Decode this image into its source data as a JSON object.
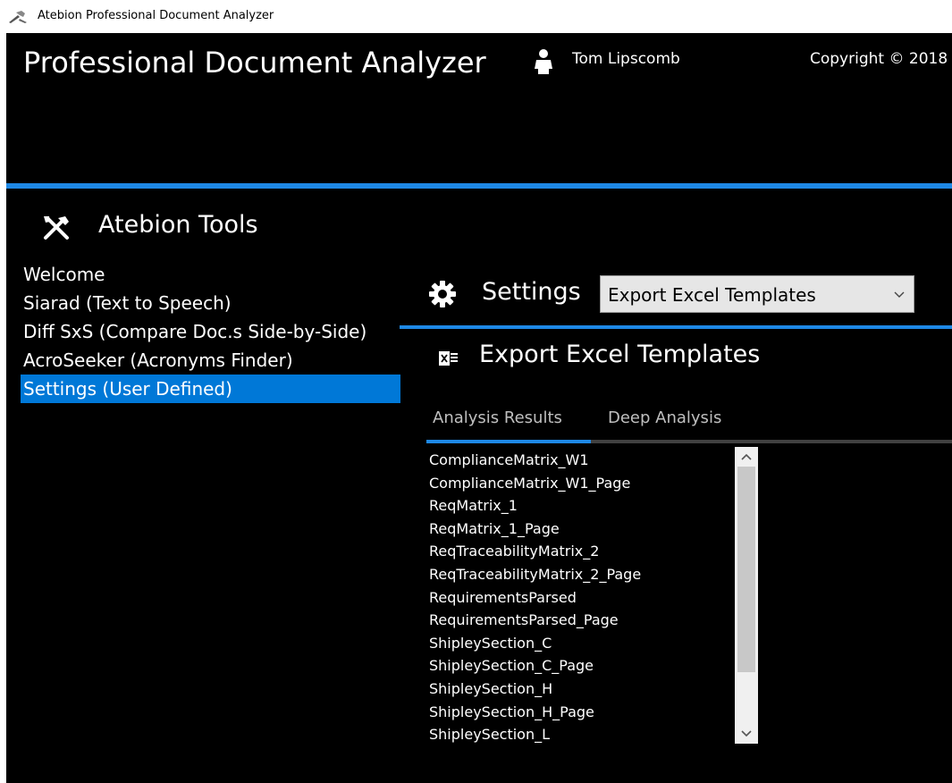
{
  "window": {
    "title": "Atebion Professional Document Analyzer",
    "icon": "tools-icon"
  },
  "header": {
    "title": "Professional Document Analyzer",
    "user_icon": "user-icon",
    "user_name": "Tom Lipscomb",
    "copyright": "Copyright © 2018"
  },
  "tools": {
    "title": "Atebion Tools",
    "icon": "tools-icon",
    "selected_index": 4,
    "items": [
      {
        "label": "Welcome"
      },
      {
        "label": "Siarad (Text to Speech)"
      },
      {
        "label": "Diff SxS (Compare Doc.s Side-by-Side)"
      },
      {
        "label": "AcroSeeker (Acronyms Finder)"
      },
      {
        "label": "Settings (User Defined)"
      }
    ]
  },
  "settings": {
    "title": "Settings",
    "icon": "gear-icon",
    "dropdown_value": "Export Excel Templates"
  },
  "export": {
    "title": "Export Excel Templates",
    "icon": "excel-icon",
    "tabs": [
      {
        "label": "Analysis Results",
        "active": true
      },
      {
        "label": "Deep Analysis",
        "active": false
      }
    ],
    "templates": [
      "ComplianceMatrix_W1",
      "ComplianceMatrix_W1_Page",
      "ReqMatrix_1",
      "ReqMatrix_1_Page",
      "ReqTraceabilityMatrix_2",
      "ReqTraceabilityMatrix_2_Page",
      "RequirementsParsed",
      "RequirementsParsed_Page",
      "ShipleySection_C",
      "ShipleySection_C_Page",
      "ShipleySection_H",
      "ShipleySection_H_Page",
      "ShipleySection_L"
    ]
  },
  "colors": {
    "accent": "#1e88e5",
    "selection": "#0078d7",
    "background": "#000000",
    "text": "#ffffff"
  }
}
